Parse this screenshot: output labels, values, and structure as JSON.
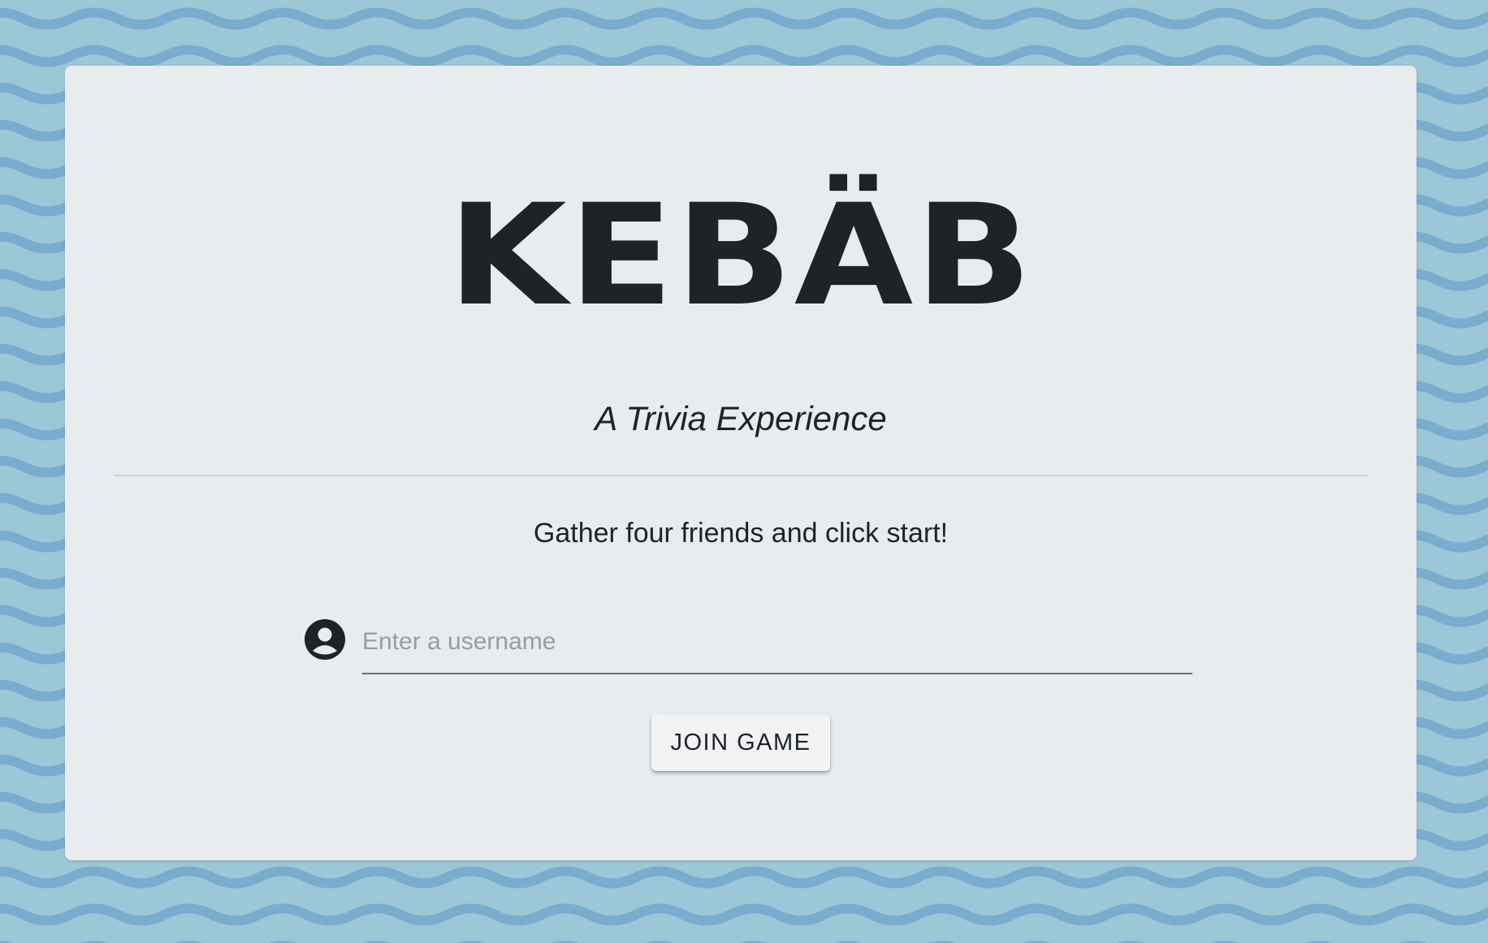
{
  "app": {
    "logo_text": "KEBÄB",
    "tagline": "A Trivia Experience",
    "instructions": "Gather four friends and click start!"
  },
  "form": {
    "username": {
      "value": "",
      "placeholder": "Enter a username",
      "icon": "account-circle-icon"
    },
    "join_label": "JOIN GAME"
  },
  "colors": {
    "background_light": "#9cc7d7",
    "background_wave": "#7aaccf",
    "card": "#e8ecef",
    "text": "#1f2226",
    "placeholder": "#9a9da0",
    "divider": "#cfd3d6"
  }
}
